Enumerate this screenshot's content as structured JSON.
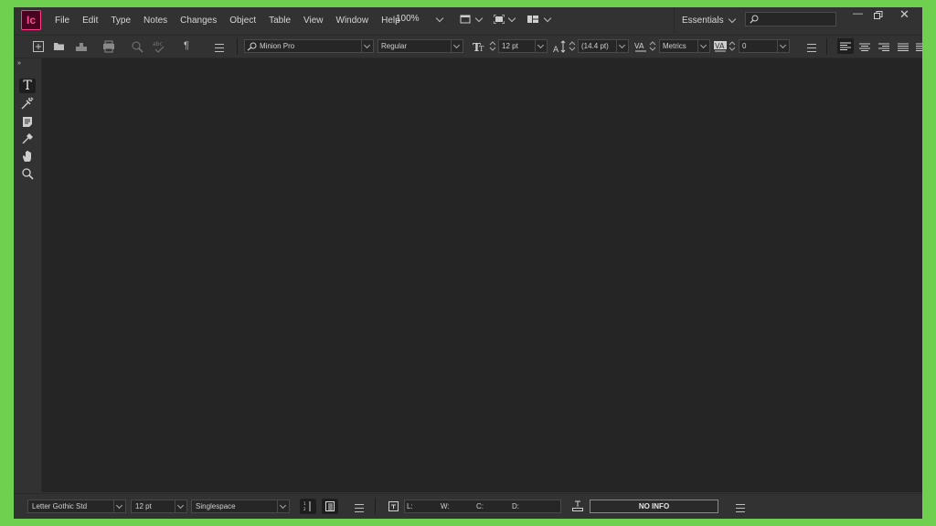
{
  "app": {
    "logo_text": "Ic",
    "accent_color": "#ff3d8b",
    "logo_bg": "#49021f"
  },
  "menubar": {
    "items": [
      "File",
      "Edit",
      "Type",
      "Notes",
      "Changes",
      "Object",
      "Table",
      "View",
      "Window",
      "Help"
    ],
    "zoom": "100%",
    "workspace": "Essentials",
    "search_placeholder": ""
  },
  "control_bar": {
    "font_family": "Minion Pro",
    "font_style": "Regular",
    "font_size": "12 pt",
    "leading": "(14.4 pt)",
    "kerning": "Metrics",
    "tracking": "0"
  },
  "tools": [
    "type-tool",
    "position-tool",
    "note-tool",
    "eyedropper-tool",
    "hand-tool",
    "zoom-tool"
  ],
  "status_bar": {
    "font": "Letter Gothic Std",
    "size": "12 pt",
    "spacing": "Singlespace",
    "labels": {
      "l": "L:",
      "w": "W:",
      "c": "C:",
      "d": "D:"
    },
    "info": "NO INFO"
  }
}
